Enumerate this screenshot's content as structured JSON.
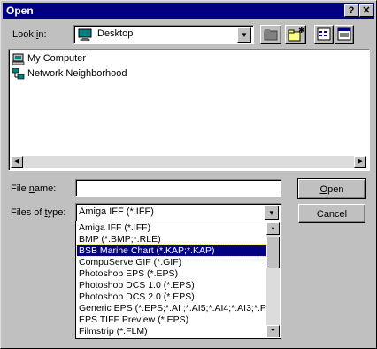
{
  "window": {
    "title": "Open",
    "help_label": "?",
    "close_label": "✕"
  },
  "look_in": {
    "label_pre": "Look ",
    "label_u": "i",
    "label_post": "n:",
    "value": "Desktop"
  },
  "file_list": [
    {
      "label": "My Computer",
      "icon": "computer-icon"
    },
    {
      "label": "Network Neighborhood",
      "icon": "network-icon"
    }
  ],
  "file_name": {
    "label_pre": "File ",
    "label_u": "n",
    "label_post": "ame:",
    "value": ""
  },
  "file_type": {
    "label_pre": "Files of ",
    "label_u": "t",
    "label_post": "ype:",
    "selected": "Amiga IFF (*.IFF)",
    "options": [
      "Amiga IFF (*.IFF)",
      "BMP (*.BMP;*.RLE)",
      "BSB Marine Chart (*.KAP;*.KAP)",
      "CompuServe GIF (*.GIF)",
      "Photoshop EPS (*.EPS)",
      "Photoshop DCS 1.0 (*.EPS)",
      "Photoshop DCS 2.0 (*.EPS)",
      "Generic EPS (*.EPS;*.AI ;*.AI5;*.AI4;*.AI3;*.P",
      "EPS TIFF Preview (*.EPS)",
      "Filmstrip (*.FLM)"
    ],
    "highlighted_index": 2
  },
  "buttons": {
    "open_u": "O",
    "open_rest": "pen",
    "cancel": "Cancel"
  },
  "icons": [
    "up-folder-icon",
    "new-folder-icon",
    "list-view-icon",
    "details-view-icon"
  ]
}
